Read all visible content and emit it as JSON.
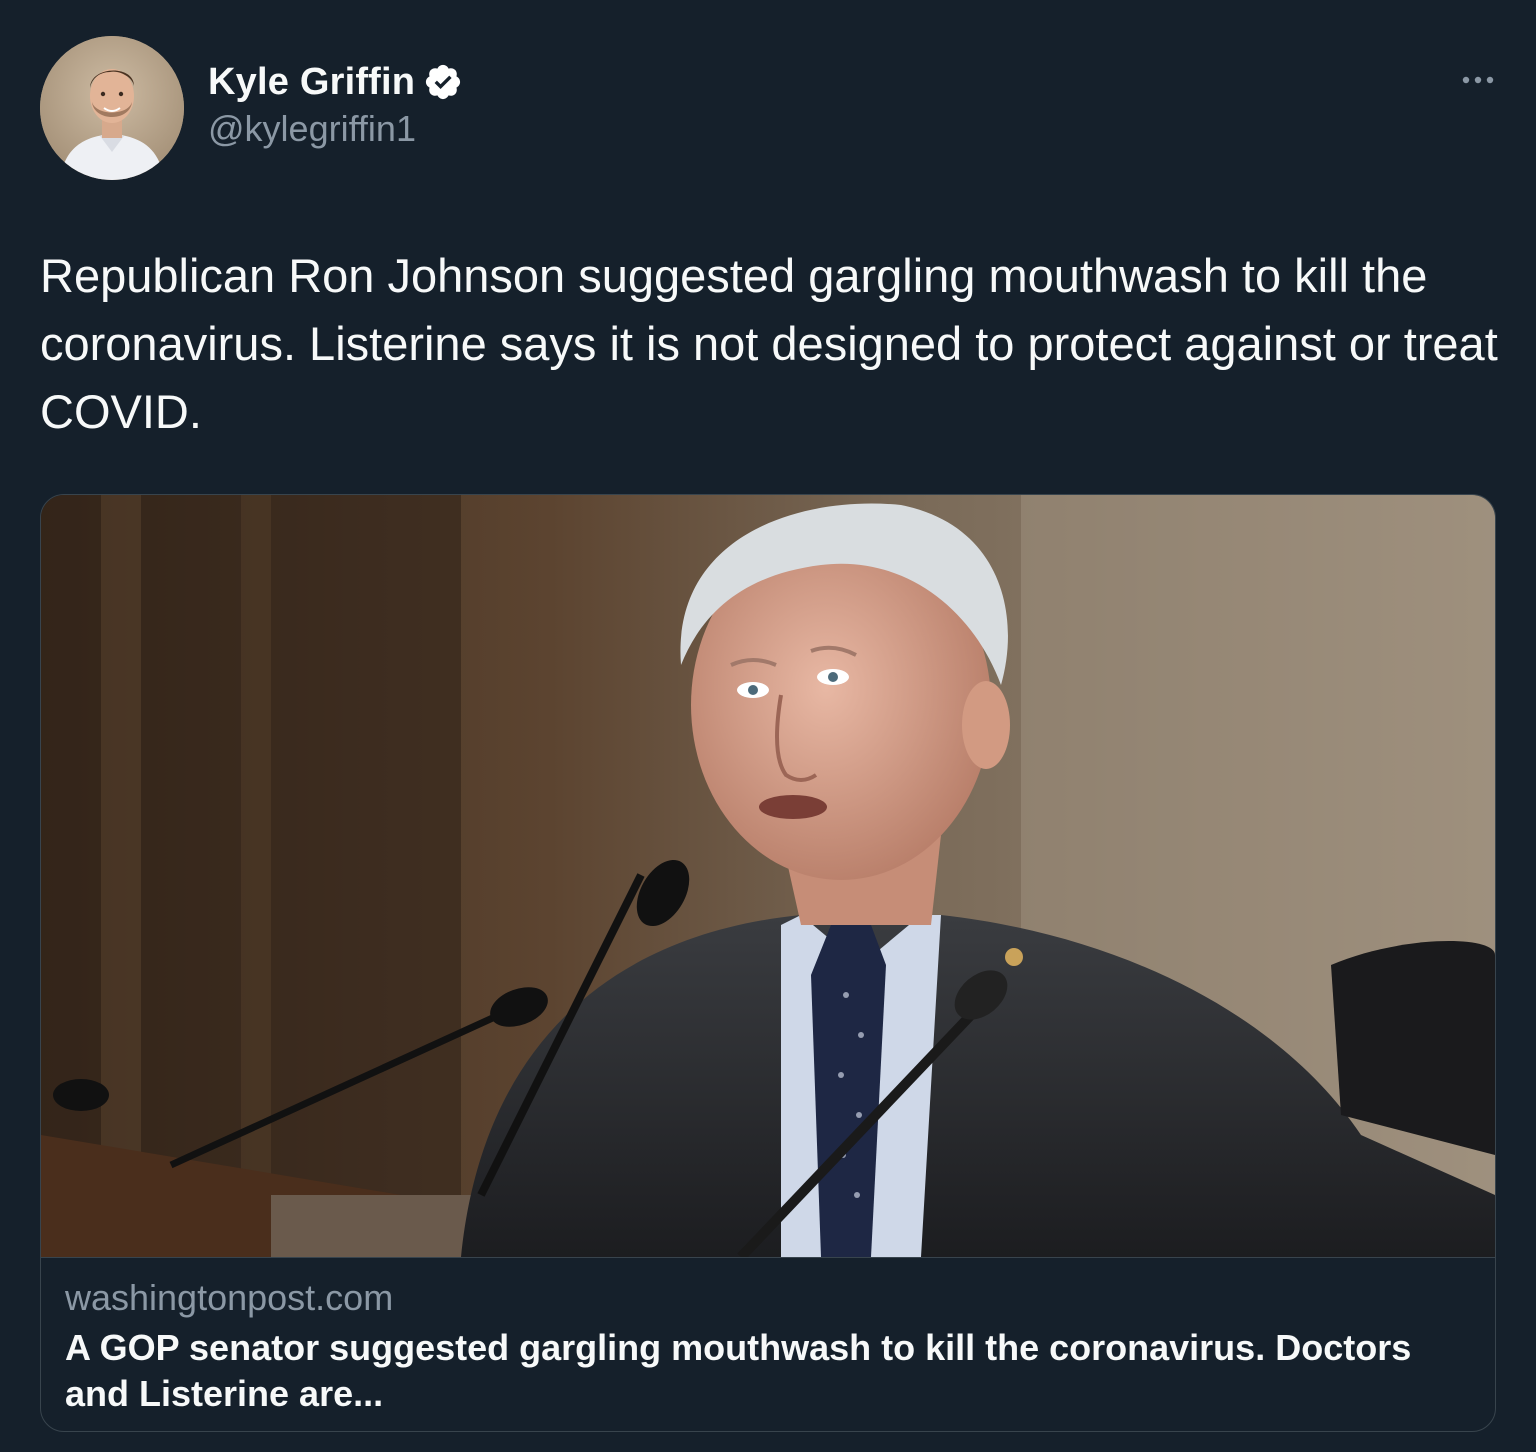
{
  "author": {
    "name": "Kyle Griffin",
    "handle": "@kylegriffin1",
    "verified": true,
    "avatar_icon": "profile-photo"
  },
  "tweet": {
    "text": "Republican Ron Johnson suggested gargling mouthwash to kill the coronavirus. Listerine says it is not designed to protect against or treat COVID."
  },
  "menu": {
    "icon": "more-options-icon"
  },
  "card": {
    "image_icon": "news-photo",
    "domain": "washingtonpost.com",
    "title": "A GOP senator suggested gargling mouthwash to kill the coronavirus. Doctors and Listerine are..."
  },
  "colors": {
    "background": "#15202b",
    "text_primary": "#f7f9f9",
    "text_secondary": "#8b98a5",
    "border": "#38444d",
    "verified_badge": "#ffffff"
  }
}
